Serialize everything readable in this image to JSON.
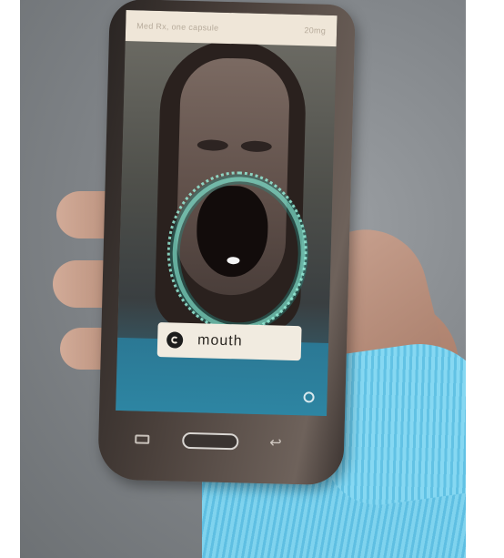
{
  "phone_app": {
    "prescription_label": "Med Rx, one capsule",
    "dose": "20mg",
    "detection_label": "mouth"
  },
  "icons": {
    "badge": "camera-check-icon",
    "corner": "info-icon",
    "nav_menu": "menu-icon",
    "nav_home": "home-button",
    "nav_back": "back-icon"
  },
  "colors": {
    "ring": "#78dcc8",
    "label_bg": "#f1ebe0",
    "glove": "#7fd3ee"
  }
}
